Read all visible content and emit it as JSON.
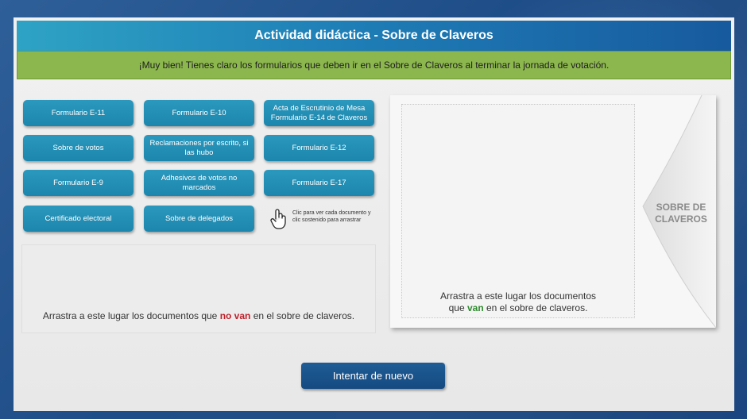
{
  "title": "Actividad didáctica - Sobre de Claveros",
  "feedback": "¡Muy bien! Tienes claro los formularios que deben ir en el Sobre de Claveros al terminar la jornada de votación.",
  "documents": [
    {
      "label": "Formulario E-11"
    },
    {
      "label": "Formulario E-10"
    },
    {
      "label": "Acta de Escrutinio de Mesa Formulario E-14 de Claveros"
    },
    {
      "label": "Sobre de votos"
    },
    {
      "label": "Reclamaciones por escrito, si las hubo"
    },
    {
      "label": "Formulario E-12"
    },
    {
      "label": "Formulario E-9"
    },
    {
      "label": "Adhesivos de votos no marcados"
    },
    {
      "label": "Formulario E-17"
    },
    {
      "label": "Certificado electoral"
    },
    {
      "label": "Sobre de delegados"
    }
  ],
  "hint": {
    "icon": "hand-pointer-icon",
    "text": "Clic para ver cada documento y clic sostenido para arrastrar"
  },
  "drop_no_van": {
    "before": "Arrastra a este lugar los documentos que",
    "highlight": "no van",
    "after": "en el sobre de claveros."
  },
  "drop_van": {
    "line1": "Arrastra a este lugar los documentos",
    "before": "que",
    "highlight": "van",
    "after": "en el sobre de claveros."
  },
  "envelope_label": {
    "line1": "SOBRE DE",
    "line2": "CLAVEROS"
  },
  "retry_label": "Intentar de nuevo",
  "colors": {
    "title_start": "#2ea3c4",
    "title_end": "#175a9e",
    "feedback_bg": "#8cb74e",
    "button_bg": "#1d86ad",
    "no_van": "#c0202a",
    "van": "#2f8a2f",
    "retry_bg": "#154a80"
  }
}
